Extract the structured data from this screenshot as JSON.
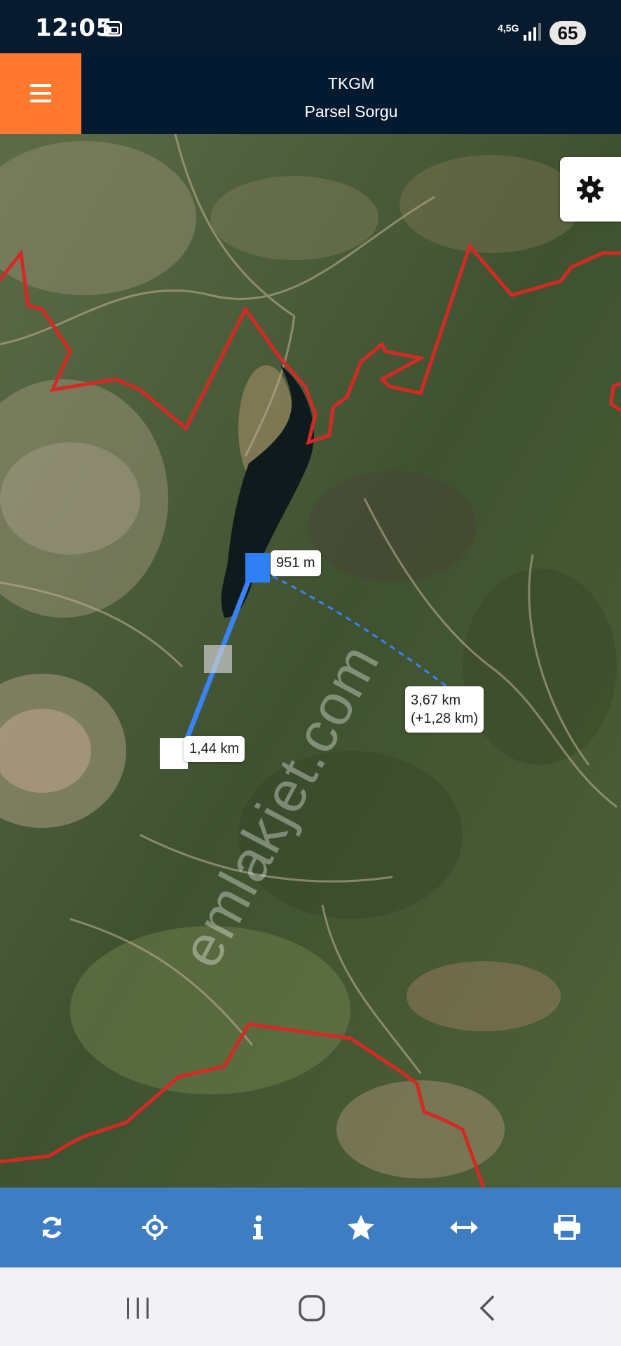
{
  "status_bar": {
    "time": "12:05",
    "network": "4,5G",
    "battery": "65"
  },
  "app_bar": {
    "title": "TKGM",
    "subtitle": "Parsel Sorgu"
  },
  "map": {
    "measure_labels": {
      "first": "951 m",
      "second": "1,44 km",
      "total_line1": "3,67 km",
      "total_line2": "(+1,28 km)"
    },
    "watermark": "emlakjet.com",
    "colors": {
      "boundary": "#d42a25",
      "measure_line": "#3b82f6"
    }
  },
  "toolbar": {
    "icons": [
      "refresh-icon",
      "locate-icon",
      "info-icon",
      "star-icon",
      "measure-icon",
      "print-icon"
    ]
  },
  "nav": {
    "icons": [
      "recent-apps-icon",
      "home-icon",
      "back-icon"
    ]
  }
}
